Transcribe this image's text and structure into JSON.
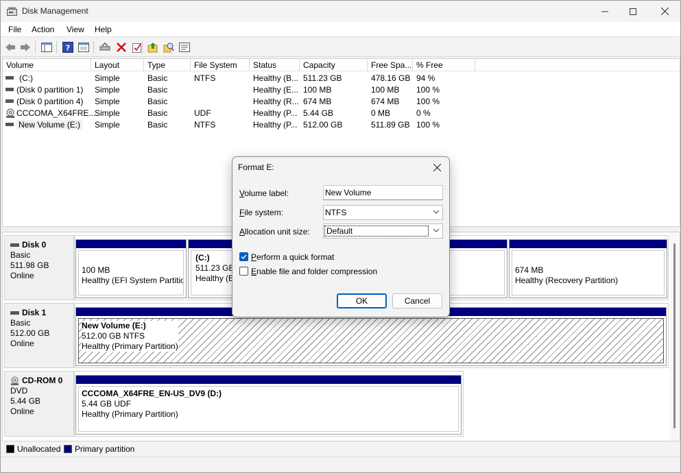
{
  "window": {
    "title": "Disk Management"
  },
  "menu": [
    "File",
    "Action",
    "View",
    "Help"
  ],
  "toolbar": {
    "icons": [
      "back-arrow-icon",
      "forward-arrow-icon",
      "console-tree-icon",
      "help-icon",
      "show-pane-icon",
      "connect-disk-icon",
      "delete-icon",
      "check-icon",
      "folder-up-icon",
      "search-disk-icon",
      "properties-icon"
    ]
  },
  "volume_list": {
    "columns": [
      "Volume",
      "Layout",
      "Type",
      "File System",
      "Status",
      "Capacity",
      "Free Spa...",
      "% Free"
    ],
    "rows": [
      {
        "volume": "(C:)",
        "layout": "Simple",
        "type": "Basic",
        "fs": "NTFS",
        "status": "Healthy (B...",
        "capacity": "511.23 GB",
        "free": "478.16 GB",
        "pct": "94 %"
      },
      {
        "volume": "(Disk 0 partition 1)",
        "layout": "Simple",
        "type": "Basic",
        "fs": "",
        "status": "Healthy (E...",
        "capacity": "100 MB",
        "free": "100 MB",
        "pct": "100 %"
      },
      {
        "volume": "(Disk 0 partition 4)",
        "layout": "Simple",
        "type": "Basic",
        "fs": "",
        "status": "Healthy (R...",
        "capacity": "674 MB",
        "free": "674 MB",
        "pct": "100 %"
      },
      {
        "volume": "CCCOMA_X64FRE...",
        "layout": "Simple",
        "type": "Basic",
        "fs": "UDF",
        "status": "Healthy (P...",
        "capacity": "5.44 GB",
        "free": "0 MB",
        "pct": "0 %"
      },
      {
        "volume": "New Volume (E:)",
        "layout": "Simple",
        "type": "Basic",
        "fs": "NTFS",
        "status": "Healthy (P...",
        "capacity": "512.00 GB",
        "free": "511.89 GB",
        "pct": "100 %"
      }
    ]
  },
  "disks": [
    {
      "name": "Disk 0",
      "kind": "Basic",
      "size": "511.98 GB",
      "state": "Online",
      "partitions": [
        {
          "title": "",
          "line1": "100 MB",
          "line2": "Healthy (EFI System Partition"
        },
        {
          "title": "(C:)",
          "line1": "511.23 GB N",
          "line2": "Healthy (Bo"
        },
        {
          "title": "",
          "line1": "674 MB",
          "line2": "Healthy (Recovery Partition)"
        }
      ]
    },
    {
      "name": "Disk 1",
      "kind": "Basic",
      "size": "512.00 GB",
      "state": "Online",
      "partitions": [
        {
          "title": "New Volume  (E:)",
          "line1": "512.00 GB NTFS",
          "line2": "Healthy (Primary Partition)"
        }
      ]
    },
    {
      "name": "CD-ROM 0",
      "kind": "DVD",
      "size": "5.44 GB",
      "state": "Online",
      "partitions": [
        {
          "title": "CCCOMA_X64FRE_EN-US_DV9  (D:)",
          "line1": "5.44 GB UDF",
          "line2": "Healthy (Primary Partition)"
        }
      ]
    }
  ],
  "legend": [
    {
      "label": "Unallocated",
      "color": "#000000"
    },
    {
      "label": "Primary partition",
      "color": "#00007f"
    }
  ],
  "dialog": {
    "title": "Format E:",
    "volume_label": {
      "label_u": "V",
      "label_rest": "olume label:",
      "value": "New Volume"
    },
    "file_system": {
      "label_u": "F",
      "label_rest": "ile system:",
      "value": "NTFS"
    },
    "allocation": {
      "label_u": "A",
      "label_rest": "llocation unit size:",
      "value": "Default"
    },
    "quick_format": {
      "label_u": "P",
      "label_rest": "erform a quick format",
      "checked": true
    },
    "compression": {
      "label_u": "E",
      "label_rest": "nable file and folder compression",
      "checked": false
    },
    "ok_label": "OK",
    "cancel_label": "Cancel"
  }
}
